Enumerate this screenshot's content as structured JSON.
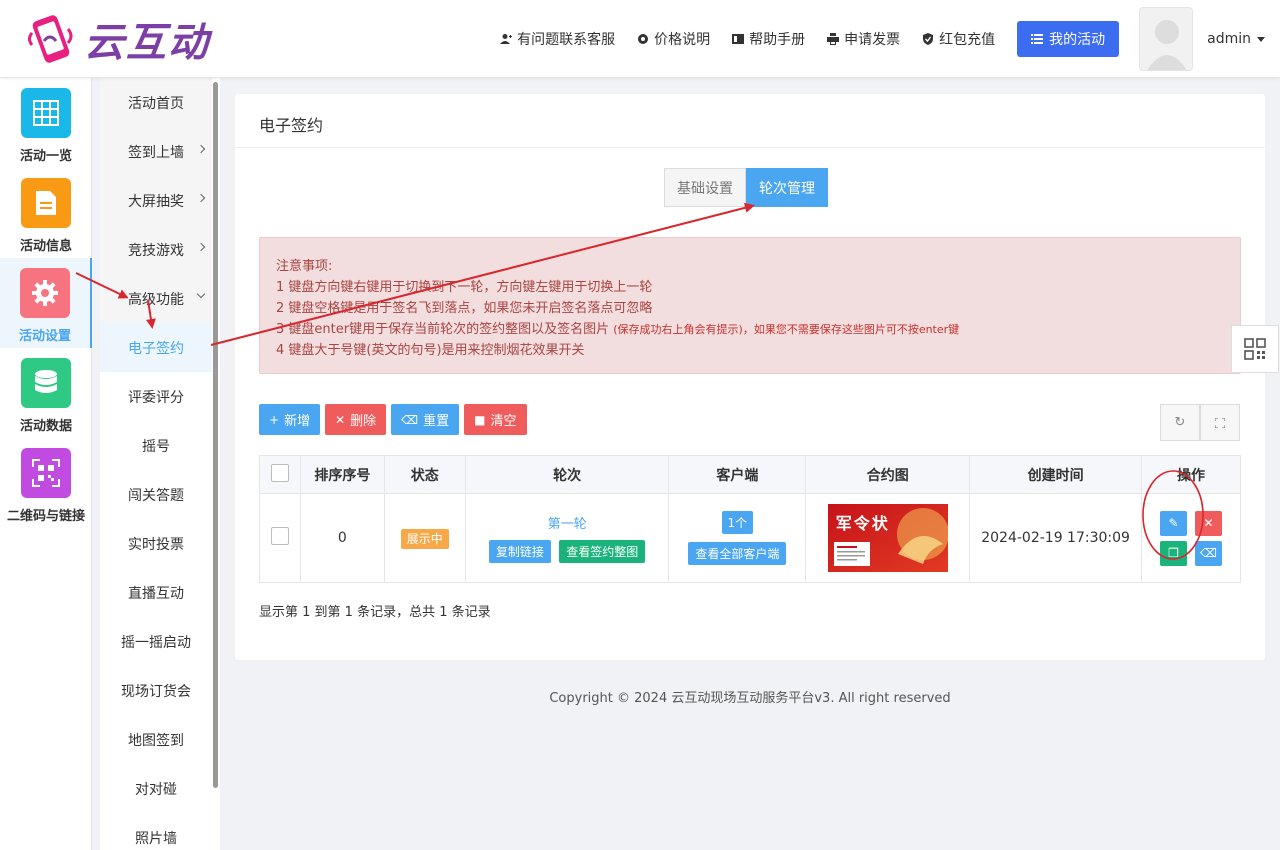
{
  "header": {
    "logo_text": "云互动",
    "nav": [
      {
        "label": "有问题联系客服",
        "icon": "user-add-icon"
      },
      {
        "label": "价格说明",
        "icon": "gear-icon"
      },
      {
        "label": "帮助手册",
        "icon": "book-icon"
      },
      {
        "label": "申请发票",
        "icon": "printer-icon"
      },
      {
        "label": "红包充值",
        "icon": "shield-check-icon"
      }
    ],
    "my_activity": "我的活动",
    "user": "admin"
  },
  "rail": [
    {
      "label": "活动一览",
      "color": "#1ab7e9",
      "icon": "grid-icon"
    },
    {
      "label": "活动信息",
      "color": "#f99a15",
      "icon": "document-icon"
    },
    {
      "label": "活动设置",
      "color": "#f7737f",
      "icon": "gear-icon",
      "active": true
    },
    {
      "label": "活动数据",
      "color": "#2ec985",
      "icon": "database-icon"
    },
    {
      "label": "二维码与链接",
      "color": "#c14be0",
      "icon": "qrcode-icon"
    }
  ],
  "submenu": [
    "活动首页",
    "签到上墙",
    "大屏抽奖",
    "竞技游戏",
    "高级功能",
    "电子签约",
    "评委评分",
    "摇号",
    "闯关答题",
    "实时投票",
    "直播互动",
    "摇一摇启动",
    "现场订货会",
    "地图签到",
    "对对碰",
    "照片墙"
  ],
  "panel": {
    "title": "电子签约",
    "tabs": [
      "基础设置",
      "轮次管理"
    ],
    "notice": {
      "heading": "注意事项:",
      "line1": "1 键盘方向键右键用于切换到下一轮，方向键左键用于切换上一轮",
      "line2": "2 键盘空格键是用于签名飞到落点，如果您未开启签名落点可忽略",
      "line3": "3 键盘enter键用于保存当前轮次的签约整图以及签名图片",
      "line3_small": "(保存成功右上角会有提示)，如果您不需要保存这些图片可不按enter键",
      "line4": "4 键盘大于号键(英文的句号)是用来控制烟花效果开关"
    },
    "toolbar": {
      "add": "新增",
      "delete": "删除",
      "reset": "重置",
      "clear": "清空"
    },
    "table": {
      "headers": [
        "排序序号",
        "状态",
        "轮次",
        "客户端",
        "合约图",
        "创建时间",
        "操作"
      ],
      "rows": [
        {
          "order": "0",
          "status": "展示中",
          "round": "第一轮",
          "copy_link": "复制链接",
          "view_sign": "查看签约整图",
          "client_count": "1个",
          "view_clients": "查看全部客户端",
          "contract_text": "军令状",
          "created": "2024-02-19 17:30:09"
        }
      ]
    },
    "pager": "显示第 1 到第 1 条记录，总共 1 条记录"
  },
  "footer": "Copyright © 2024 云互动现场互动服务平台v3. All right reserved",
  "colors": {
    "primary": "#4aa6f0",
    "danger": "#f05b5b",
    "success": "#1ab37b",
    "annotation": "#d9272e"
  }
}
